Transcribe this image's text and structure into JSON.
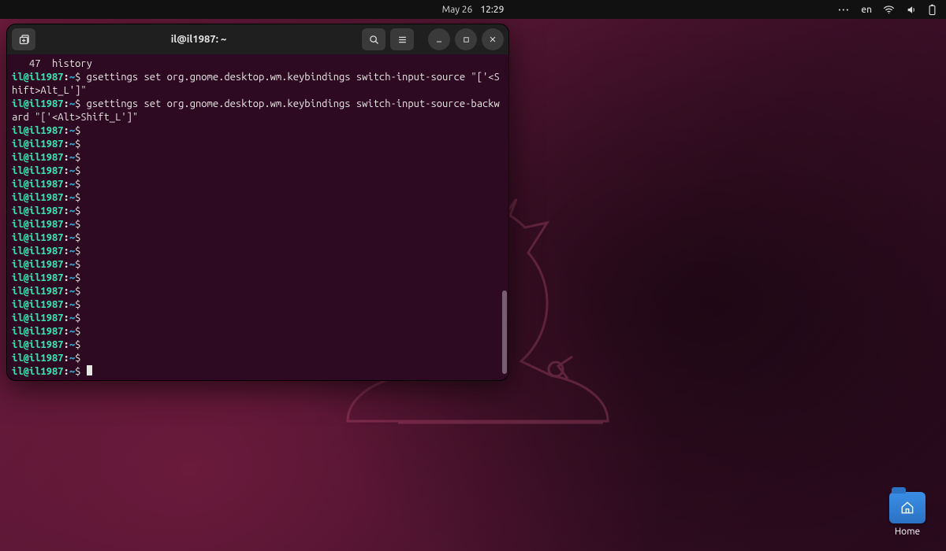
{
  "topbar": {
    "date": "May 26",
    "time": "12:29",
    "lang": "en"
  },
  "desktop": {
    "home_label": "Home"
  },
  "terminal": {
    "title": "il@il1987: ~",
    "prompt": {
      "user": "il@il1987",
      "host_sep": ":",
      "cwd": "~",
      "tail": "$"
    },
    "lines": [
      {
        "type": "plain",
        "text": "   47  history"
      },
      {
        "type": "cmd",
        "text": "gsettings set org.gnome.desktop.wm.keybindings switch-input-source \"['<Shift>Alt_L']\""
      },
      {
        "type": "cmd",
        "text": "gsettings set org.gnome.desktop.wm.keybindings switch-input-source-backward \"['<Alt>Shift_L']\""
      },
      {
        "type": "empty"
      },
      {
        "type": "empty"
      },
      {
        "type": "empty"
      },
      {
        "type": "empty"
      },
      {
        "type": "empty"
      },
      {
        "type": "empty"
      },
      {
        "type": "empty"
      },
      {
        "type": "empty"
      },
      {
        "type": "empty"
      },
      {
        "type": "empty"
      },
      {
        "type": "empty"
      },
      {
        "type": "empty"
      },
      {
        "type": "empty"
      },
      {
        "type": "empty"
      },
      {
        "type": "empty"
      },
      {
        "type": "empty"
      },
      {
        "type": "empty"
      },
      {
        "type": "empty"
      },
      {
        "type": "cursor"
      }
    ]
  },
  "colors": {
    "prompt_user": "#34e2b0",
    "prompt_tilde": "#29aad4",
    "terminal_bg": "#2d0a22",
    "titlebar_bg": "#1f1f1f"
  }
}
